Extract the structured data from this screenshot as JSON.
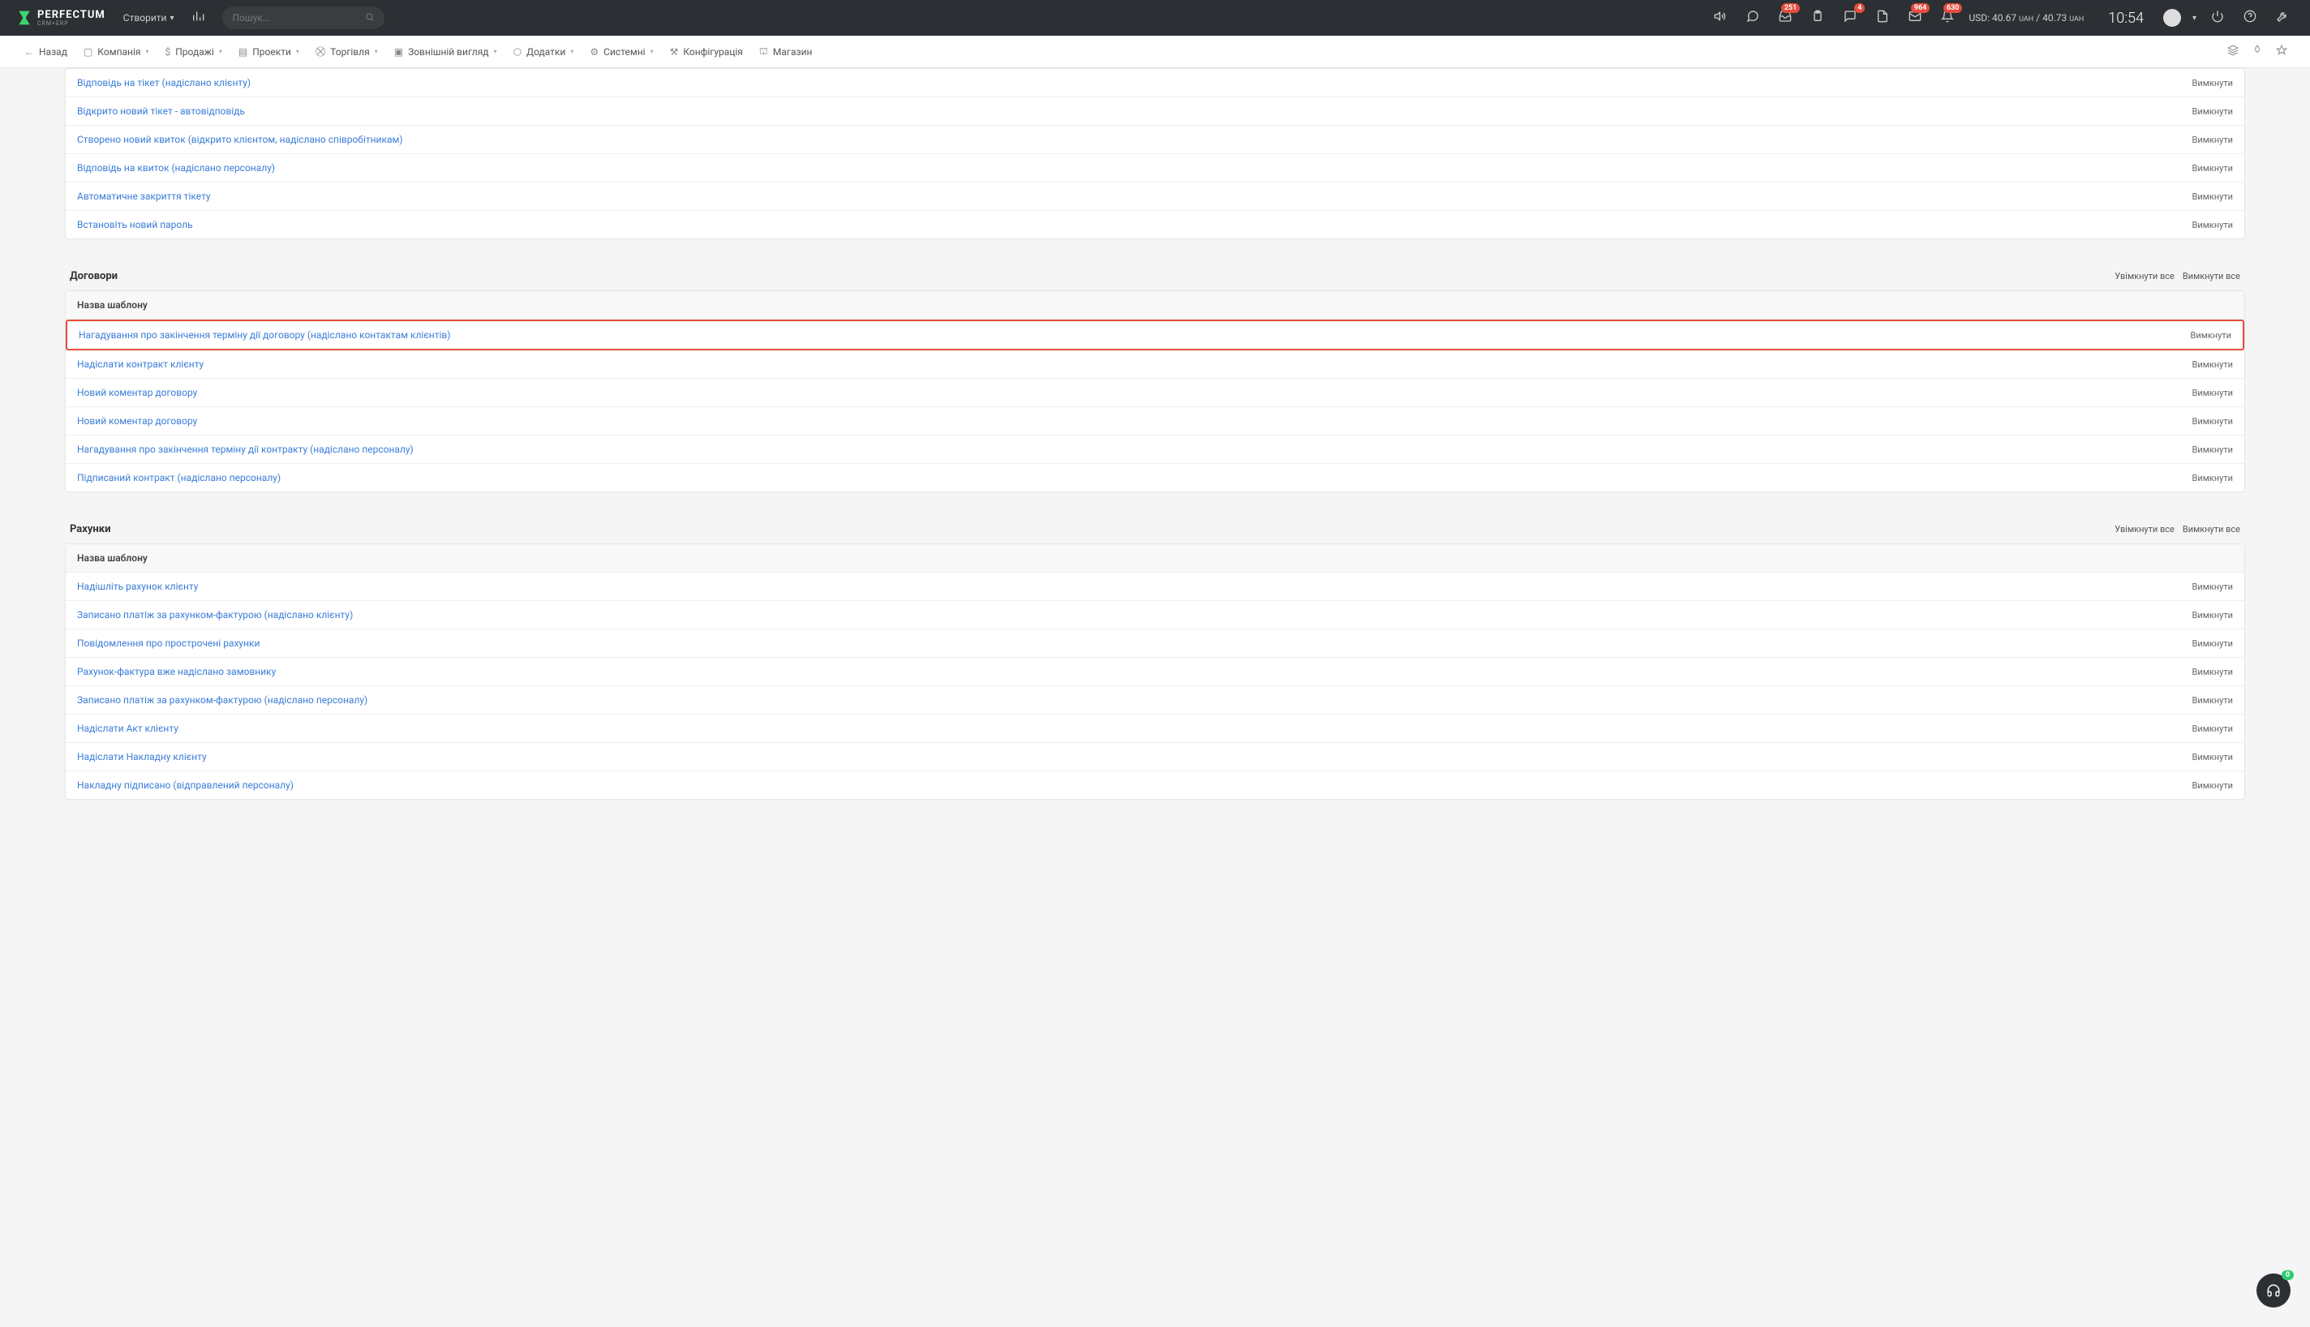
{
  "header": {
    "logo": {
      "main": "PERFECTUM",
      "sub": "CRM+ERP"
    },
    "create": "Створити",
    "search_placeholder": "Пошук...",
    "badges": {
      "b1": "251",
      "b2": "4",
      "b3": "964",
      "b4": "630"
    },
    "currency": {
      "label": "USD:",
      "v1": "40.67",
      "u1": "UAH",
      "sep": "/",
      "v2": "40.73",
      "u2": "UAH"
    },
    "clock": "10:54"
  },
  "nav": {
    "back": "Назад",
    "items": [
      "Компанія",
      "Продажі",
      "Проекти",
      "Торгівля",
      "Зовнішній вигляд",
      "Додатки",
      "Системні",
      "Конфігурація",
      "Магазин"
    ]
  },
  "tickets_rows": [
    "Відповідь на тікет (надіслано клієнту)",
    "Відкрито новий тікет - автовідповідь",
    "Створено новий квиток (відкрито клієнтом, надіслано співробітникам)",
    "Відповідь на квиток (надіслано персоналу)",
    "Автоматичне закриття тікету",
    "Встановіть новий пароль"
  ],
  "action_disable": "Вимкнути",
  "sections": {
    "contracts": {
      "title": "Договори",
      "enable_all": "Увімкнути все",
      "disable_all": "Вимкнути все",
      "col": "Назва шаблону",
      "rows": [
        "Нагадування про закінчення терміну дії договору (надіслано контактам клієнтів)",
        "Надіслати контракт клієнту",
        "Новий коментар договору",
        "Новий коментар договору",
        "Нагадування про закінчення терміну дії контракту (надіслано персоналу)",
        "Підписаний контракт (надіслано персоналу)"
      ],
      "highlighted_index": 0
    },
    "invoices": {
      "title": "Рахунки",
      "enable_all": "Увімкнути все",
      "disable_all": "Вимкнути все",
      "col": "Назва шаблону",
      "rows": [
        "Надішліть рахунок клієнту",
        "Записано платіж за рахунком-фактурою (надіслано клієнту)",
        "Повідомлення про прострочені рахунки",
        "Рахунок-фактура вже надіслано замовнику",
        "Записано платіж за рахунком-фактурою (надіслано персоналу)",
        "Надіслати Акт клієнту",
        "Надіслати Накладну клієнту",
        "Накладну підписано (відправлений персоналу)"
      ]
    }
  },
  "fab_badge": "0"
}
